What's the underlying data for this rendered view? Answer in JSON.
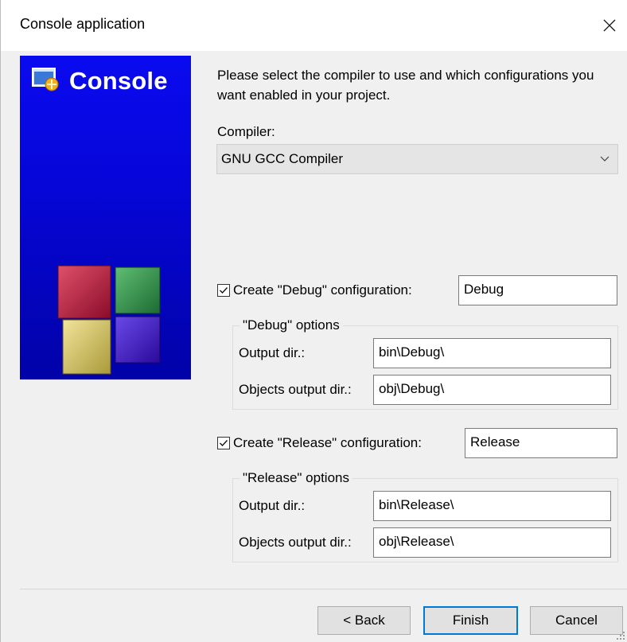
{
  "window": {
    "title": "Console application"
  },
  "banner": {
    "title": "Console"
  },
  "intro_text": "Please select the compiler to use and which configurations you want enabled in your project.",
  "compiler": {
    "label": "Compiler:",
    "value": "GNU GCC Compiler"
  },
  "debug": {
    "checkbox_label": "Create \"Debug\" configuration:",
    "checked": true,
    "name": "Debug",
    "group_title": "\"Debug\" options",
    "output_dir_label": "Output dir.:",
    "output_dir": "bin\\Debug\\",
    "objects_dir_label": "Objects output dir.:",
    "objects_dir": "obj\\Debug\\"
  },
  "release": {
    "checkbox_label": "Create \"Release\" configuration:",
    "checked": true,
    "name": "Release",
    "group_title": "\"Release\" options",
    "output_dir_label": "Output dir.:",
    "output_dir": "bin\\Release\\",
    "objects_dir_label": "Objects output dir.:",
    "objects_dir": "obj\\Release\\"
  },
  "buttons": {
    "back": "< Back",
    "finish": "Finish",
    "cancel": "Cancel"
  },
  "colors": {
    "banner_blue": "#0606d8",
    "focus_blue": "#0078d7",
    "dialog_bg": "#f0f0f0"
  },
  "icons": [
    "close-icon",
    "console-logo-icon",
    "cubes-logo-icon",
    "chevron-down-icon",
    "checkmark-icon",
    "resize-grip-icon"
  ]
}
